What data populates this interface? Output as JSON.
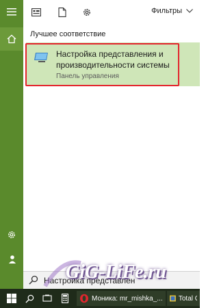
{
  "toolbar": {
    "filters_label": "Фильтры"
  },
  "results": {
    "section_title": "Лучшее соответствие",
    "best_match": {
      "title": "Настройка представления и производительности системы",
      "subtitle": "Панель управления"
    }
  },
  "search": {
    "query": "Настройка представлен"
  },
  "watermark": {
    "text": "GiG-LiFe.ru"
  },
  "taskbar": {
    "items": [
      {
        "label": "Моника: mr_mishka_..."
      },
      {
        "label": "Total Co"
      }
    ]
  },
  "colors": {
    "rail": "#5a8a2c",
    "highlight": "#cfe6b8",
    "outline": "#e3232b",
    "taskbar": "#1f2b1a"
  }
}
